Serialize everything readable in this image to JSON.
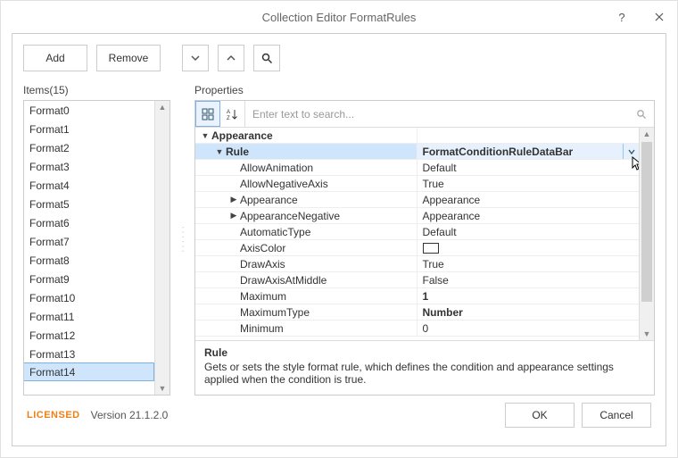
{
  "window": {
    "title": "Collection Editor FormatRules"
  },
  "toolbar": {
    "add": "Add",
    "remove": "Remove"
  },
  "items": {
    "label": "Items(15)",
    "rows": [
      "Format0",
      "Format1",
      "Format2",
      "Format3",
      "Format4",
      "Format5",
      "Format6",
      "Format7",
      "Format8",
      "Format9",
      "Format10",
      "Format11",
      "Format12",
      "Format13",
      "Format14"
    ],
    "selected": "Format14"
  },
  "properties": {
    "label": "Properties",
    "search_placeholder": "Enter text to search...",
    "groups": {
      "appearance": "Appearance",
      "rule_label": "Rule",
      "rule_value": "FormatConditionRuleDataBar",
      "rows": [
        {
          "name": "AllowAnimation",
          "value": "Default"
        },
        {
          "name": "AllowNegativeAxis",
          "value": "True"
        },
        {
          "name": "Appearance",
          "value": "Appearance",
          "expandable": true
        },
        {
          "name": "AppearanceNegative",
          "value": "Appearance",
          "expandable": true
        },
        {
          "name": "AutomaticType",
          "value": "Default"
        },
        {
          "name": "AxisColor",
          "value": "__swatch__"
        },
        {
          "name": "DrawAxis",
          "value": "True"
        },
        {
          "name": "DrawAxisAtMiddle",
          "value": "False"
        },
        {
          "name": "Maximum",
          "value": "1",
          "bold": true
        },
        {
          "name": "MaximumType",
          "value": "Number",
          "bold": true
        },
        {
          "name": "Minimum",
          "value": "0"
        }
      ]
    },
    "description": {
      "title": "Rule",
      "body": "Gets or sets the style format rule, which defines the condition and appearance settings applied when the condition is true."
    }
  },
  "footer": {
    "licensed": "LICENSED",
    "version": "Version 21.1.2.0",
    "ok": "OK",
    "cancel": "Cancel"
  }
}
